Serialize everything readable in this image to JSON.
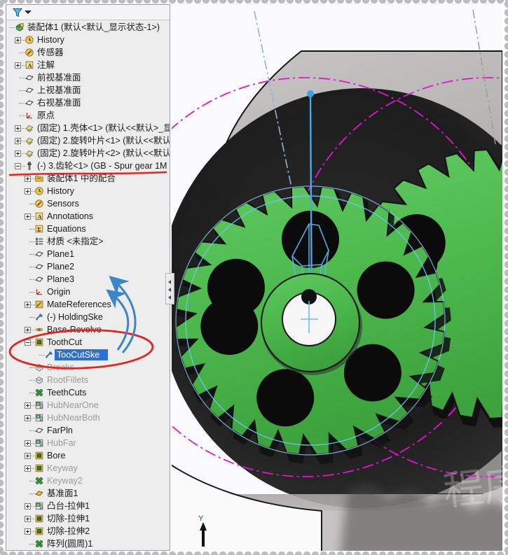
{
  "app": {
    "accent_blue": "#2c6fd6",
    "gear_green": "#4cb84c",
    "anno_red": "#e8231c",
    "anno_blue": "#3a86c8",
    "pitch_magenta": "#e612d0",
    "sketch_cyan": "#5ab4ef"
  },
  "tree_toolbar": {
    "filter_icon": "filter-funnel-icon",
    "caret_icon": "chevron-down-icon"
  },
  "tree": {
    "items": [
      {
        "label": "装配体1  (默认<默认_显示状态-1>)",
        "depth": 0,
        "icon": "assembly-icon",
        "expander": "none",
        "state": "normal"
      },
      {
        "label": "History",
        "depth": 1,
        "icon": "history-icon",
        "expander": "plus",
        "state": "normal"
      },
      {
        "label": "传感器",
        "depth": 1,
        "icon": "sensor-icon",
        "expander": "none",
        "state": "normal"
      },
      {
        "label": "注解",
        "depth": 1,
        "icon": "annotations-icon",
        "expander": "plus",
        "state": "normal"
      },
      {
        "label": "前视基准面",
        "depth": 1,
        "icon": "plane-icon",
        "expander": "none",
        "state": "normal"
      },
      {
        "label": "上视基准面",
        "depth": 1,
        "icon": "plane-icon",
        "expander": "none",
        "state": "normal"
      },
      {
        "label": "右视基准面",
        "depth": 1,
        "icon": "plane-icon",
        "expander": "none",
        "state": "normal"
      },
      {
        "label": "原点",
        "depth": 1,
        "icon": "origin-icon",
        "expander": "none",
        "state": "normal"
      },
      {
        "label": "(固定) 1.壳体<1>  (默认<<默认>_显",
        "depth": 1,
        "icon": "part-icon",
        "expander": "plus",
        "state": "normal"
      },
      {
        "label": "(固定) 2.旋转叶片<1>  (默认<<默认",
        "depth": 1,
        "icon": "part-icon",
        "expander": "plus",
        "state": "normal"
      },
      {
        "label": "(固定) 2.旋转叶片<2>  (默认<<默认",
        "depth": 1,
        "icon": "part-icon",
        "expander": "plus",
        "state": "normal"
      },
      {
        "label": "(-) 3.齿轮<1>  (GB - Spur gear 1M",
        "depth": 1,
        "icon": "toolbox-part-icon",
        "expander": "minus",
        "state": "normal"
      },
      {
        "label": "装配体1 中的配合",
        "depth": 2,
        "icon": "mates-folder-icon",
        "expander": "plus",
        "state": "normal"
      },
      {
        "label": "History",
        "depth": 2,
        "icon": "history-icon",
        "expander": "plus",
        "state": "normal"
      },
      {
        "label": "Sensors",
        "depth": 2,
        "icon": "sensor-icon",
        "expander": "none",
        "state": "normal"
      },
      {
        "label": "Annotations",
        "depth": 2,
        "icon": "annotations-icon",
        "expander": "plus",
        "state": "normal"
      },
      {
        "label": "Equations",
        "depth": 2,
        "icon": "equations-icon",
        "expander": "none",
        "state": "normal"
      },
      {
        "label": "材质 <未指定>",
        "depth": 2,
        "icon": "material-icon",
        "expander": "none",
        "state": "normal"
      },
      {
        "label": "Plane1",
        "depth": 2,
        "icon": "plane-icon",
        "expander": "none",
        "state": "normal"
      },
      {
        "label": "Plane2",
        "depth": 2,
        "icon": "plane-icon",
        "expander": "none",
        "state": "normal"
      },
      {
        "label": "Plane3",
        "depth": 2,
        "icon": "plane-icon",
        "expander": "none",
        "state": "normal"
      },
      {
        "label": "Origin",
        "depth": 2,
        "icon": "origin-icon",
        "expander": "none",
        "state": "normal"
      },
      {
        "label": "MateReferences",
        "depth": 2,
        "icon": "mate-ref-icon",
        "expander": "plus",
        "state": "normal"
      },
      {
        "label": "(-) HoldingSke",
        "depth": 2,
        "icon": "sketch-icon",
        "expander": "none",
        "state": "normal"
      },
      {
        "label": "Base-Revolve",
        "depth": 2,
        "icon": "revolve-icon",
        "expander": "plus",
        "state": "normal"
      },
      {
        "label": "ToothCut",
        "depth": 2,
        "icon": "extrude-cut-icon",
        "expander": "minus",
        "state": "normal"
      },
      {
        "label": "TooCutSke",
        "depth": 3,
        "icon": "sketch-icon",
        "expander": "none",
        "state": "selected"
      },
      {
        "label": "Breaks",
        "depth": 2,
        "icon": "feature-icon",
        "expander": "none",
        "state": "suppressed"
      },
      {
        "label": "RootFillets",
        "depth": 2,
        "icon": "feature-icon",
        "expander": "none",
        "state": "suppressed"
      },
      {
        "label": "TeethCuts",
        "depth": 2,
        "icon": "pattern-icon",
        "expander": "none",
        "state": "normal"
      },
      {
        "label": "HubNearOne",
        "depth": 2,
        "icon": "boss-extrude-icon",
        "expander": "plus",
        "state": "suppressed"
      },
      {
        "label": "HubNearBoth",
        "depth": 2,
        "icon": "boss-extrude-icon",
        "expander": "plus",
        "state": "suppressed"
      },
      {
        "label": "FarPln",
        "depth": 2,
        "icon": "plane-icon",
        "expander": "none",
        "state": "normal"
      },
      {
        "label": "HubFar",
        "depth": 2,
        "icon": "boss-extrude-icon",
        "expander": "plus",
        "state": "suppressed"
      },
      {
        "label": "Bore",
        "depth": 2,
        "icon": "extrude-cut-icon",
        "expander": "plus",
        "state": "normal"
      },
      {
        "label": "Keyway",
        "depth": 2,
        "icon": "extrude-cut-icon",
        "expander": "plus",
        "state": "suppressed"
      },
      {
        "label": "Keyway2",
        "depth": 2,
        "icon": "pattern-icon",
        "expander": "none",
        "state": "suppressed"
      },
      {
        "label": "基准面1",
        "depth": 2,
        "icon": "plane-gold-icon",
        "expander": "none",
        "state": "normal"
      },
      {
        "label": "凸台-拉伸1",
        "depth": 2,
        "icon": "boss-extrude-icon",
        "expander": "plus",
        "state": "normal"
      },
      {
        "label": "切除-拉伸1",
        "depth": 2,
        "icon": "extrude-cut-icon",
        "expander": "plus",
        "state": "normal"
      },
      {
        "label": "切除-拉伸2",
        "depth": 2,
        "icon": "extrude-cut-icon",
        "expander": "plus",
        "state": "normal"
      },
      {
        "label": "阵列(圆周)1",
        "depth": 2,
        "icon": "pattern-icon",
        "expander": "none",
        "state": "normal"
      }
    ]
  },
  "annotations": {
    "red_underline_target": "(-) 3.齿轮<1>  (GB - Spur gear 1M",
    "red_ellipse_targets": "ToothCut / TooCutSke",
    "blue_arrow_targets": "Plane3, Origin"
  },
  "viewport": {
    "triad_axis_label": "Y",
    "watermark": "程序",
    "splitter_icon": "collapse-panel-icon"
  }
}
